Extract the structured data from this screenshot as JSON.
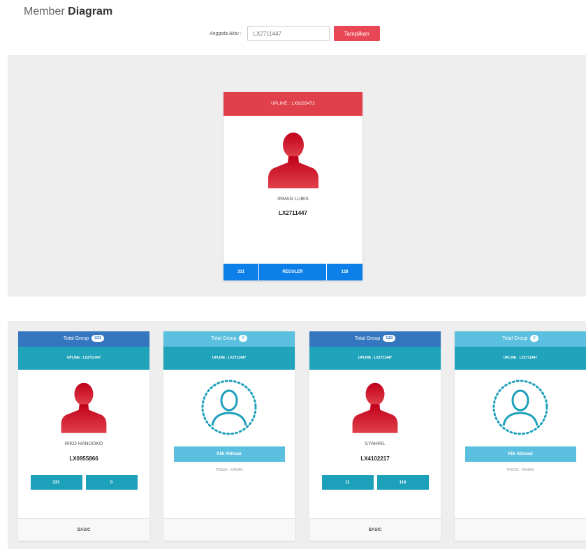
{
  "page": {
    "title_light": "Member",
    "title_bold": "Diagram"
  },
  "search": {
    "label": "Anggota Aktu :",
    "value": "LX2711447",
    "button_label": "Tampilkan"
  },
  "root": {
    "upline": "UPLINE : LX8293472",
    "name": "IRMAN LUBIS",
    "id": "LX2711447",
    "stats": [
      "331",
      "REGULER",
      "128"
    ]
  },
  "children": [
    {
      "total_label": "Total Group",
      "total_count": "331",
      "upline": "UPLINE : LX2711447",
      "active": true,
      "name": "RIKO HANDOKO",
      "id": "LX0955866",
      "counts": [
        "331",
        "0"
      ],
      "foot": "BASIC"
    },
    {
      "total_label": "Total Group",
      "total_count": "0",
      "upline": "UPLINE : LX2711447",
      "active": false,
      "activate_label": "Klik Aktivasi",
      "position": "POSISI : KANAN",
      "foot": ""
    },
    {
      "total_label": "Total Group",
      "total_count": "128",
      "upline": "UPLINE : LX2711447",
      "active": true,
      "name": "SYAHRIL",
      "id": "LX4102217",
      "counts": [
        "11",
        "116"
      ],
      "foot": "BASIC"
    },
    {
      "total_label": "Total Group",
      "total_count": "0",
      "upline": "UPLINE : LX2711447",
      "active": false,
      "activate_label": "Klik Aktivasi",
      "position": "POSISI : KANAN",
      "foot": ""
    }
  ],
  "colors": {
    "accent_red": "#e84855",
    "upline_teal": "#20a3bb",
    "total_dark": "#3577bf",
    "total_light": "#5bbfe0",
    "root_footer_blue": "#0d7fe8"
  },
  "icons": {
    "active_member": "user-red-icon",
    "empty_slot": "user-outline-icon"
  }
}
